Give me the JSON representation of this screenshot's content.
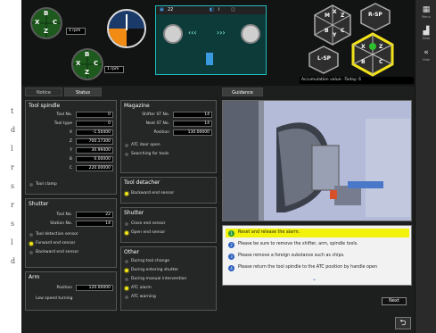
{
  "left_strip": {
    "glyphs": [
      "t",
      "d",
      "l",
      "r",
      "s",
      "r",
      "s",
      "l",
      "d"
    ]
  },
  "tabs": [
    {
      "label": "Notice"
    },
    {
      "label": "Status"
    },
    {
      "label": "Guidance"
    }
  ],
  "top": {
    "dial1": {
      "letters": [
        "B",
        "X",
        "C",
        "Z"
      ],
      "speed": "1 rpm"
    },
    "dial2": {
      "letters": [
        "B",
        "X",
        "C",
        "Z"
      ],
      "speed": "1 rpm"
    },
    "view_bar": {
      "item1": "22",
      "item2": "i"
    },
    "hex_main": {
      "letters": [
        "M",
        "X",
        "Z",
        "B",
        "Y",
        "C"
      ]
    },
    "hex_r": "R-SP",
    "hex_l": "L-SP",
    "hex_active": {
      "letters": [
        "X",
        "Z",
        "B",
        "C"
      ]
    },
    "accumulation": "Accumulation value: -Today: 6"
  },
  "tool_spindle": {
    "title": "Tool spindle",
    "rows": [
      {
        "label": "Tool No.",
        "value": "0"
      },
      {
        "label": "Tool type",
        "value": "0"
      },
      {
        "label": "X",
        "value": "-1.50400"
      },
      {
        "label": "Z",
        "value": "700.17300"
      },
      {
        "label": "Y",
        "value": "30.99400"
      },
      {
        "label": "B",
        "value": "0.00000"
      },
      {
        "label": "C",
        "value": "220.00000"
      }
    ],
    "lamp": "Tool clamp"
  },
  "shutter": {
    "title": "Shutter",
    "rows": [
      {
        "label": "Tool No.",
        "value": "22"
      },
      {
        "label": "Station No.",
        "value": "14"
      }
    ],
    "lamps": [
      {
        "text": "Tool detection sensor",
        "on": false
      },
      {
        "text": "Forward end sensor",
        "on": true
      },
      {
        "text": "Backward end sensor",
        "on": false
      }
    ]
  },
  "arm": {
    "title": "Arm",
    "rows": [
      {
        "label": "Position",
        "value": "120.00000"
      }
    ],
    "lamps": [
      {
        "text": "Low speed turning",
        "on": false
      }
    ]
  },
  "magazine": {
    "title": "Magazine",
    "rows": [
      {
        "label": "Shifter ST No.",
        "value": "14"
      },
      {
        "label": "Next ST No.",
        "value": "14"
      },
      {
        "label": "Position",
        "value": "130.00000"
      }
    ],
    "lamps": [
      {
        "text": "ATC door open",
        "on": false
      },
      {
        "text": "Searching for tools",
        "on": false
      }
    ]
  },
  "tool_detacher": {
    "title": "Tool detacher",
    "lamps": [
      {
        "text": "Backward end sensor",
        "on": true
      }
    ]
  },
  "shutter2": {
    "title": "Shutter",
    "lamps": [
      {
        "text": "Close end sensor",
        "on": false
      },
      {
        "text": "Open end sensor",
        "on": true
      }
    ]
  },
  "other": {
    "title": "Other",
    "lamps": [
      {
        "text": "During tool change",
        "on": false
      },
      {
        "text": "During entering shutter",
        "on": true
      },
      {
        "text": "During manual intervention",
        "on": false
      },
      {
        "text": "ATC alarm",
        "on": true
      },
      {
        "text": "ATC warning",
        "on": false
      }
    ]
  },
  "guidance": {
    "messages": [
      {
        "num": "1",
        "text": "Reset and release the alarm."
      },
      {
        "num": "2",
        "text": "Please be sure to remove the shifter, arm, spindle tools."
      },
      {
        "num": "3",
        "text": "Please remove a foreign substance such as chips."
      },
      {
        "num": "4",
        "text": "Please return the tool spindle to the ATC position by handle open"
      }
    ],
    "next": "Next"
  },
  "right_tools": [
    {
      "icon": "grid-icon",
      "caption": "Menu"
    },
    {
      "icon": "chart-icon",
      "caption": "Data"
    },
    {
      "icon": "double-left-icon",
      "caption": "Hide"
    }
  ],
  "colors": {
    "accent_yellow": "#f2e21a",
    "hmi_bg": "#1c1f1e",
    "highlight": "#f2f20a"
  }
}
